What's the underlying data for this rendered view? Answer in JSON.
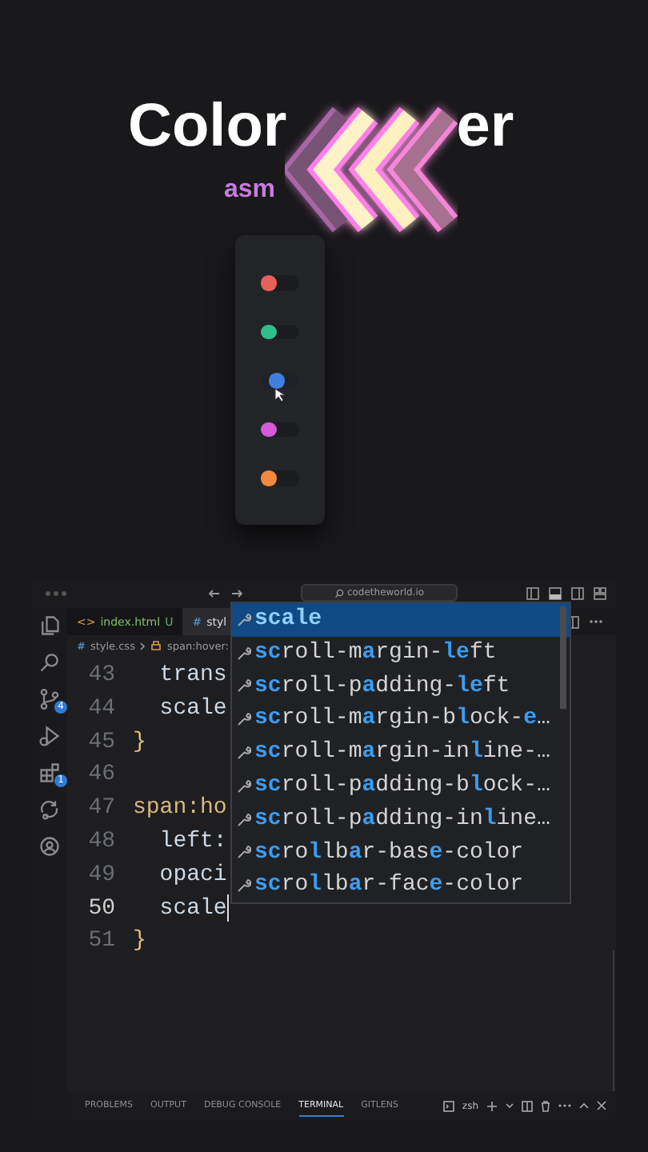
{
  "header": {
    "title_left": "Color",
    "title_right": "er",
    "subtitle": "asm"
  },
  "picker": {
    "toggles": [
      {
        "color": "#e8605a",
        "on": false
      },
      {
        "color": "#2fbf8a",
        "on": false
      },
      {
        "color": "#3f7fe0",
        "on": true
      },
      {
        "color": "#d65ad8",
        "on": false
      },
      {
        "color": "#f0883e",
        "on": false
      }
    ]
  },
  "window": {
    "search": "codetheworld.io"
  },
  "activity_bar": [
    {
      "kind": "files"
    },
    {
      "kind": "search"
    },
    {
      "kind": "scm",
      "badge": "4"
    },
    {
      "kind": "debug"
    },
    {
      "kind": "extensions",
      "badge": "1"
    },
    {
      "kind": "remote"
    },
    {
      "kind": "accounts"
    }
  ],
  "tabs": [
    {
      "icon": "<>",
      "label": "index.html",
      "status": "U",
      "selected": false
    },
    {
      "icon": "#",
      "label": "styl",
      "selected": true
    }
  ],
  "breadcrumb": {
    "icon": "#",
    "items": [
      "style.css",
      "span:hover:"
    ]
  },
  "editor": {
    "lines": [
      {
        "number": "43",
        "kind": "property",
        "code": "  trans",
        "current": false,
        "caret": false
      },
      {
        "number": "44",
        "kind": "property",
        "code": "  scale",
        "current": false,
        "caret": false
      },
      {
        "number": "45",
        "kind": "brace",
        "code": "}",
        "current": false,
        "caret": false
      },
      {
        "number": "46",
        "kind": "blank",
        "current": false,
        "caret": false
      },
      {
        "number": "47",
        "kind": "selector",
        "code": "span:ho",
        "current": false,
        "caret": false
      },
      {
        "number": "48",
        "kind": "property",
        "code": "  left:",
        "current": false,
        "caret": false
      },
      {
        "number": "49",
        "kind": "property",
        "code": "  opaci",
        "current": false,
        "caret": false
      },
      {
        "number": "50",
        "kind": "property",
        "code": "  scale",
        "current": true,
        "caret": true
      },
      {
        "number": "51",
        "kind": "brace",
        "code": "}",
        "current": false,
        "caret": false
      }
    ]
  },
  "suggestions": [
    {
      "text": "**scale**",
      "selected": true
    },
    {
      "text": "**sc**roll-m**a**rgin-**le**ft",
      "selected": false
    },
    {
      "text": "**sc**roll-p**a**dding-**le**ft",
      "selected": false
    },
    {
      "text": "**sc**roll-m**a**rgin-b**l**ock-**e**…",
      "selected": false
    },
    {
      "text": "**sc**roll-m**a**rgin-in**l**ine-…",
      "selected": false
    },
    {
      "text": "**sc**roll-p**a**dding-b**l**ock-…",
      "selected": false
    },
    {
      "text": "**sc**roll-p**a**dding-in**l**ine…",
      "selected": false
    },
    {
      "text": "**sc**ro**l**lb**a**r-bas**e**-color",
      "selected": false
    },
    {
      "text": "**sc**ro**l**lb**a**r-fac**e**-color",
      "selected": false
    }
  ],
  "panel": {
    "tabs": [
      {
        "label": "PROBLEMS",
        "selected": false
      },
      {
        "label": "OUTPUT",
        "selected": false
      },
      {
        "label": "DEBUG CONSOLE",
        "selected": false
      },
      {
        "label": "TERMINAL",
        "selected": true
      },
      {
        "label": "GITLENS",
        "selected": false
      }
    ],
    "shell": "zsh"
  }
}
